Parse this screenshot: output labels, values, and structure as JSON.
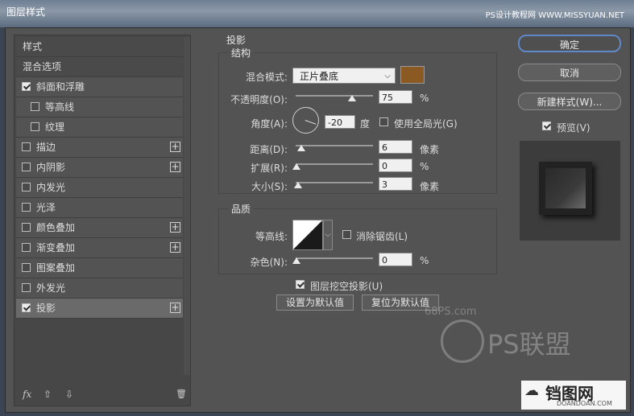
{
  "window": {
    "title": "图层样式",
    "watermark": "PS设计教程网  WWW.MISSYUAN.NET"
  },
  "left_panel": {
    "items": [
      {
        "label": "样式",
        "checkbox": false,
        "checked": false,
        "plus": false,
        "sub": false
      },
      {
        "label": "混合选项",
        "checkbox": false,
        "checked": false,
        "plus": false,
        "sub": false
      },
      {
        "label": "斜面和浮雕",
        "checkbox": true,
        "checked": true,
        "plus": false,
        "sub": false
      },
      {
        "label": "等高线",
        "checkbox": true,
        "checked": false,
        "plus": false,
        "sub": true
      },
      {
        "label": "纹理",
        "checkbox": true,
        "checked": false,
        "plus": false,
        "sub": true
      },
      {
        "label": "描边",
        "checkbox": true,
        "checked": false,
        "plus": true,
        "sub": false
      },
      {
        "label": "内阴影",
        "checkbox": true,
        "checked": false,
        "plus": true,
        "sub": false
      },
      {
        "label": "内发光",
        "checkbox": true,
        "checked": false,
        "plus": false,
        "sub": false
      },
      {
        "label": "光泽",
        "checkbox": true,
        "checked": false,
        "plus": false,
        "sub": false
      },
      {
        "label": "颜色叠加",
        "checkbox": true,
        "checked": false,
        "plus": true,
        "sub": false
      },
      {
        "label": "渐变叠加",
        "checkbox": true,
        "checked": false,
        "plus": true,
        "sub": false
      },
      {
        "label": "图案叠加",
        "checkbox": true,
        "checked": false,
        "plus": false,
        "sub": false
      },
      {
        "label": "外发光",
        "checkbox": true,
        "checked": false,
        "plus": false,
        "sub": false
      },
      {
        "label": "投影",
        "checkbox": true,
        "checked": true,
        "plus": true,
        "sub": false,
        "selected": true
      }
    ],
    "bottom": {
      "fx": "fx",
      "up": "⇧",
      "down": "⇩",
      "trash": "🗑"
    }
  },
  "drop_shadow": {
    "section_title": "投影",
    "structure": {
      "title": "结构",
      "blend_mode_label": "混合模式:",
      "blend_mode_value": "正片叠底",
      "color": "#8a5a22",
      "opacity_label": "不透明度(O):",
      "opacity_value": "75",
      "opacity_unit": "%",
      "angle_label": "角度(A):",
      "angle_value": "-20",
      "angle_unit": "度",
      "global_light_label": "使用全局光(G)",
      "distance_label": "距离(D):",
      "distance_value": "6",
      "distance_unit": "像素",
      "spread_label": "扩展(R):",
      "spread_value": "0",
      "spread_unit": "%",
      "size_label": "大小(S):",
      "size_value": "3",
      "size_unit": "像素"
    },
    "quality": {
      "title": "品质",
      "contour_label": "等高线:",
      "antialias_label": "消除锯齿(L)",
      "noise_label": "杂色(N):",
      "noise_value": "0",
      "noise_unit": "%"
    },
    "knockout_label": "图层挖空投影(U)",
    "make_default": "设置为默认值",
    "reset_default": "复位为默认值"
  },
  "right_panel": {
    "ok": "确定",
    "cancel": "取消",
    "new_style": "新建样式(W)...",
    "preview_label": "预览(V)"
  },
  "watermarks": {
    "ps_site": "68PS.com",
    "ps_logo": "PS联盟",
    "site_logo": "铛图网",
    "site_url": "DOANDOAN.COM"
  }
}
